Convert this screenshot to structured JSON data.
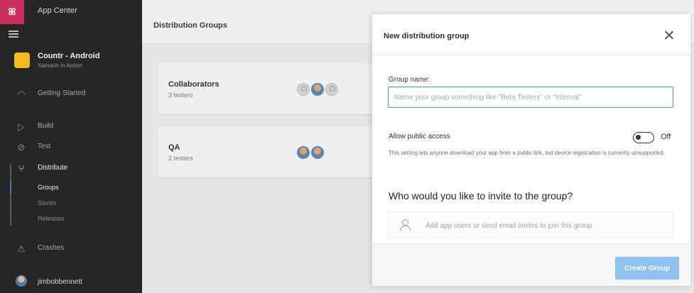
{
  "brand": {
    "logo_text": "ꕤ",
    "title": "App Center"
  },
  "app": {
    "name": "Countr - Android",
    "subtitle": "Xamarin In Action"
  },
  "nav": {
    "getting_started": "Getting Started",
    "build": "Build",
    "test": "Test",
    "distribute": "Distribute",
    "sub": {
      "groups": "Groups",
      "stores": "Stores",
      "releases": "Releases"
    },
    "crashes": "Crashes"
  },
  "user": {
    "name": "jimbobbennett"
  },
  "main": {
    "title": "Distribution Groups",
    "groups": [
      {
        "name": "Collaborators",
        "count": "3 testers"
      },
      {
        "name": "QA",
        "count": "2 testers"
      }
    ]
  },
  "modal": {
    "title": "New distribution group",
    "group_name_label": "Group name:",
    "group_name_placeholder": "Name your group something like “Beta Testers” or “Internal”",
    "public_label": "Allow public access",
    "public_toggle_state": "Off",
    "public_desc": "This setting lets anyone download your app from a public link, but device registration is currently unsupported.",
    "invite_heading": "Who would you like to invite to the group?",
    "invite_placeholder": "Add app users or send email invites to join this group",
    "create_button": "Create Group"
  },
  "colors": {
    "brand": "#cc2e5d",
    "accent": "#4a90e2",
    "create_button": "#8fc2ef"
  }
}
